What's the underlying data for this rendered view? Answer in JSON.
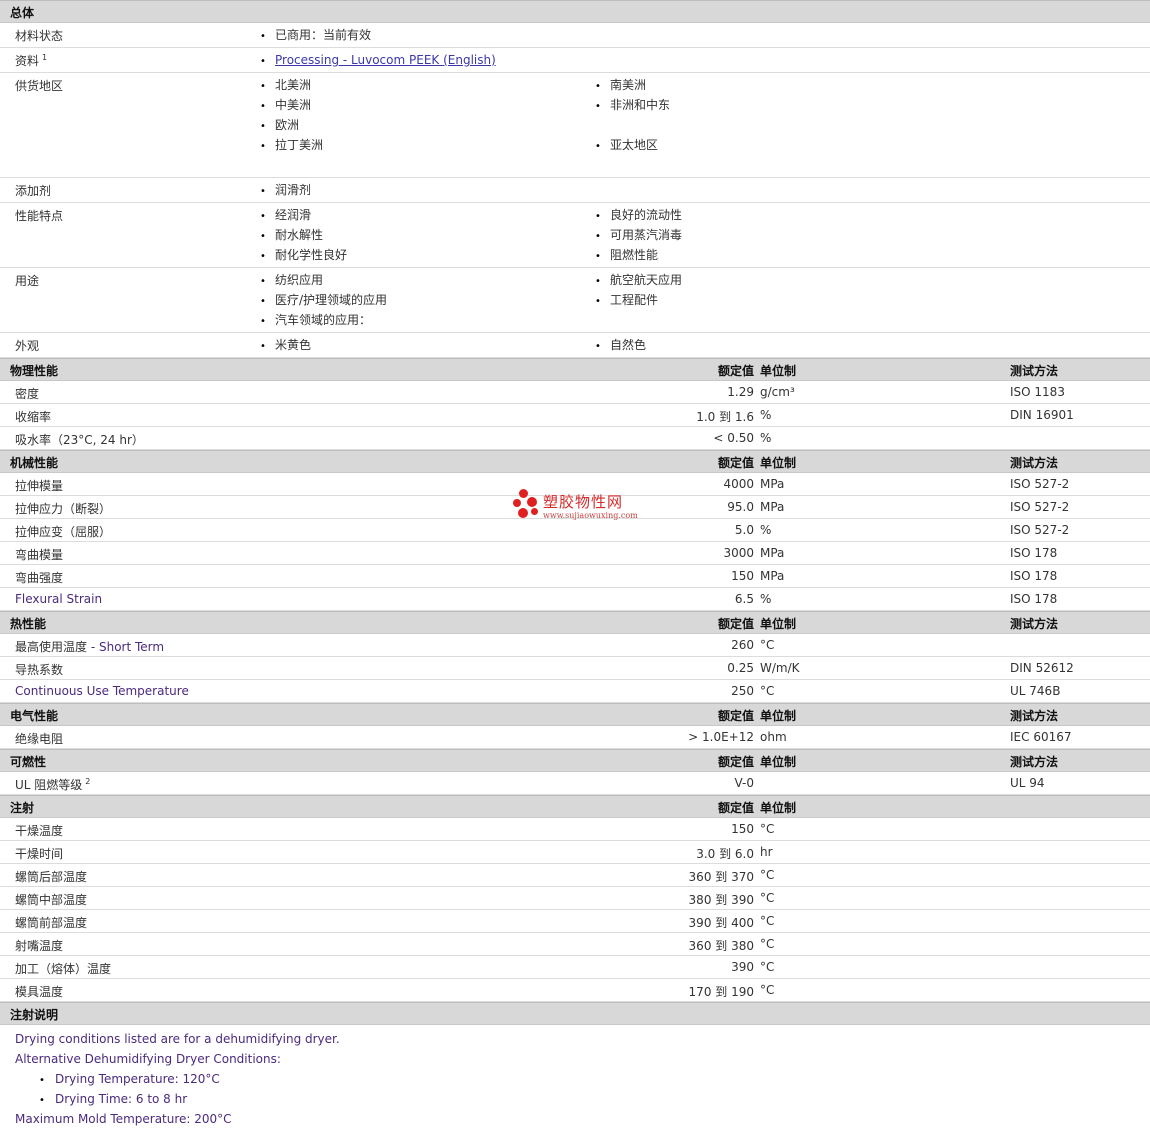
{
  "general": {
    "title": "总体",
    "rows": [
      {
        "label": "材料状态",
        "items": [
          "已商用：当前有效"
        ]
      },
      {
        "label": "资料",
        "sup": "1",
        "items": [
          "Processing - Luvocom PEEK (English)"
        ],
        "link": true
      },
      {
        "label": "供货地区",
        "items": [
          "北美洲",
          "南美洲",
          "中美洲",
          "非洲和中东",
          "欧洲",
          "",
          "拉丁美洲",
          "亚太地区",
          ""
        ]
      },
      {
        "label": "添加剂",
        "items": [
          "润滑剂"
        ]
      },
      {
        "label": "性能特点",
        "items": [
          "经润滑",
          "良好的流动性",
          "耐水解性",
          "可用蒸汽消毒",
          "耐化学性良好",
          "阻燃性能"
        ]
      },
      {
        "label": "用途",
        "items": [
          "纺织应用",
          "航空航天应用",
          "医疗/护理领域的应用",
          "工程配件",
          "汽车领域的应用：",
          ""
        ]
      },
      {
        "label": "外观",
        "items": [
          "米黄色",
          "自然色"
        ]
      }
    ]
  },
  "physical": {
    "title": "物理性能",
    "col_value": "额定值",
    "col_unit": "单位制",
    "col_test": "测试方法",
    "rows": [
      {
        "label": "密度",
        "value": "1.29",
        "unit": "g/cm³",
        "test": "ISO 1183"
      },
      {
        "label": "收缩率",
        "value": "1.0 到  1.6",
        "unit": "%",
        "test": "DIN 16901"
      },
      {
        "label": "吸水率（23°C, 24 hr）",
        "value": "< 0.50",
        "unit": "%",
        "test": ""
      }
    ]
  },
  "mechanical": {
    "title": "机械性能",
    "col_value": "额定值",
    "col_unit": "单位制",
    "col_test": "测试方法",
    "rows": [
      {
        "label": "拉伸模量",
        "value": "4000",
        "unit": "MPa",
        "test": "ISO 527-2"
      },
      {
        "label": "拉伸应力（断裂）",
        "value": "95.0",
        "unit": "MPa",
        "test": "ISO 527-2"
      },
      {
        "label": "拉伸应变（屈服）",
        "value": "5.0",
        "unit": "%",
        "test": "ISO 527-2"
      },
      {
        "label": "弯曲模量",
        "value": "3000",
        "unit": "MPa",
        "test": "ISO 178"
      },
      {
        "label": "弯曲强度",
        "value": "150",
        "unit": "MPa",
        "test": "ISO 178"
      },
      {
        "label": "Flexural Strain",
        "value": "6.5",
        "unit": "%",
        "test": "ISO 178",
        "purple": true
      }
    ]
  },
  "thermal": {
    "title": "热性能",
    "col_value": "额定值",
    "col_unit": "单位制",
    "col_test": "测试方法",
    "rows": [
      {
        "label": "最高使用温度",
        "label_extra": " - Short Term",
        "value": "260",
        "unit": "°C",
        "test": ""
      },
      {
        "label": "导热系数",
        "value": "0.25",
        "unit": "W/m/K",
        "test": "DIN 52612"
      },
      {
        "label": "Continuous Use Temperature",
        "value": "250",
        "unit": "°C",
        "test": "UL 746B",
        "purple": true
      }
    ]
  },
  "electrical": {
    "title": "电气性能",
    "col_value": "额定值",
    "col_unit": "单位制",
    "col_test": "测试方法",
    "rows": [
      {
        "label": "绝缘电阻",
        "value": "> 1.0E+12",
        "unit": "ohm",
        "test": "IEC 60167"
      }
    ]
  },
  "flammability": {
    "title": "可燃性",
    "col_value": "额定值",
    "col_unit": "单位制",
    "col_test": "测试方法",
    "rows": [
      {
        "label": "UL 阻燃等级",
        "sup": "2",
        "value": "V-0",
        "unit": "",
        "test": "UL 94"
      }
    ]
  },
  "injection": {
    "title": "注射",
    "col_value": "额定值",
    "col_unit": "单位制",
    "col_test": "",
    "rows": [
      {
        "label": "干燥温度",
        "value": "150",
        "unit": "°C"
      },
      {
        "label": "干燥时间",
        "value": "3.0 到  6.0",
        "unit": "hr"
      },
      {
        "label": "螺筒后部温度",
        "value": "360 到  370",
        "unit": "°C"
      },
      {
        "label": "螺筒中部温度",
        "value": "380 到  390",
        "unit": "°C"
      },
      {
        "label": "螺筒前部温度",
        "value": "390 到  400",
        "unit": "°C"
      },
      {
        "label": "射嘴温度",
        "value": "360 到  380",
        "unit": "°C"
      },
      {
        "label": "加工（熔体）温度",
        "value": "390",
        "unit": "°C"
      },
      {
        "label": "模具温度",
        "value": "170 到  190",
        "unit": "°C"
      }
    ]
  },
  "notes": {
    "title": "注射说明",
    "line1": "Drying conditions listed are for a dehumidifying dryer.",
    "line2": "Alternative Dehumidifying Dryer Conditions:",
    "bullet1": "Drying Temperature: 120°C",
    "bullet2": "Drying Time: 6 to 8 hr",
    "line3": "Maximum Mold Temperature: 200°C"
  },
  "watermark": {
    "name": "塑胶物性网",
    "url": "www.sujiaowuxing.com"
  }
}
